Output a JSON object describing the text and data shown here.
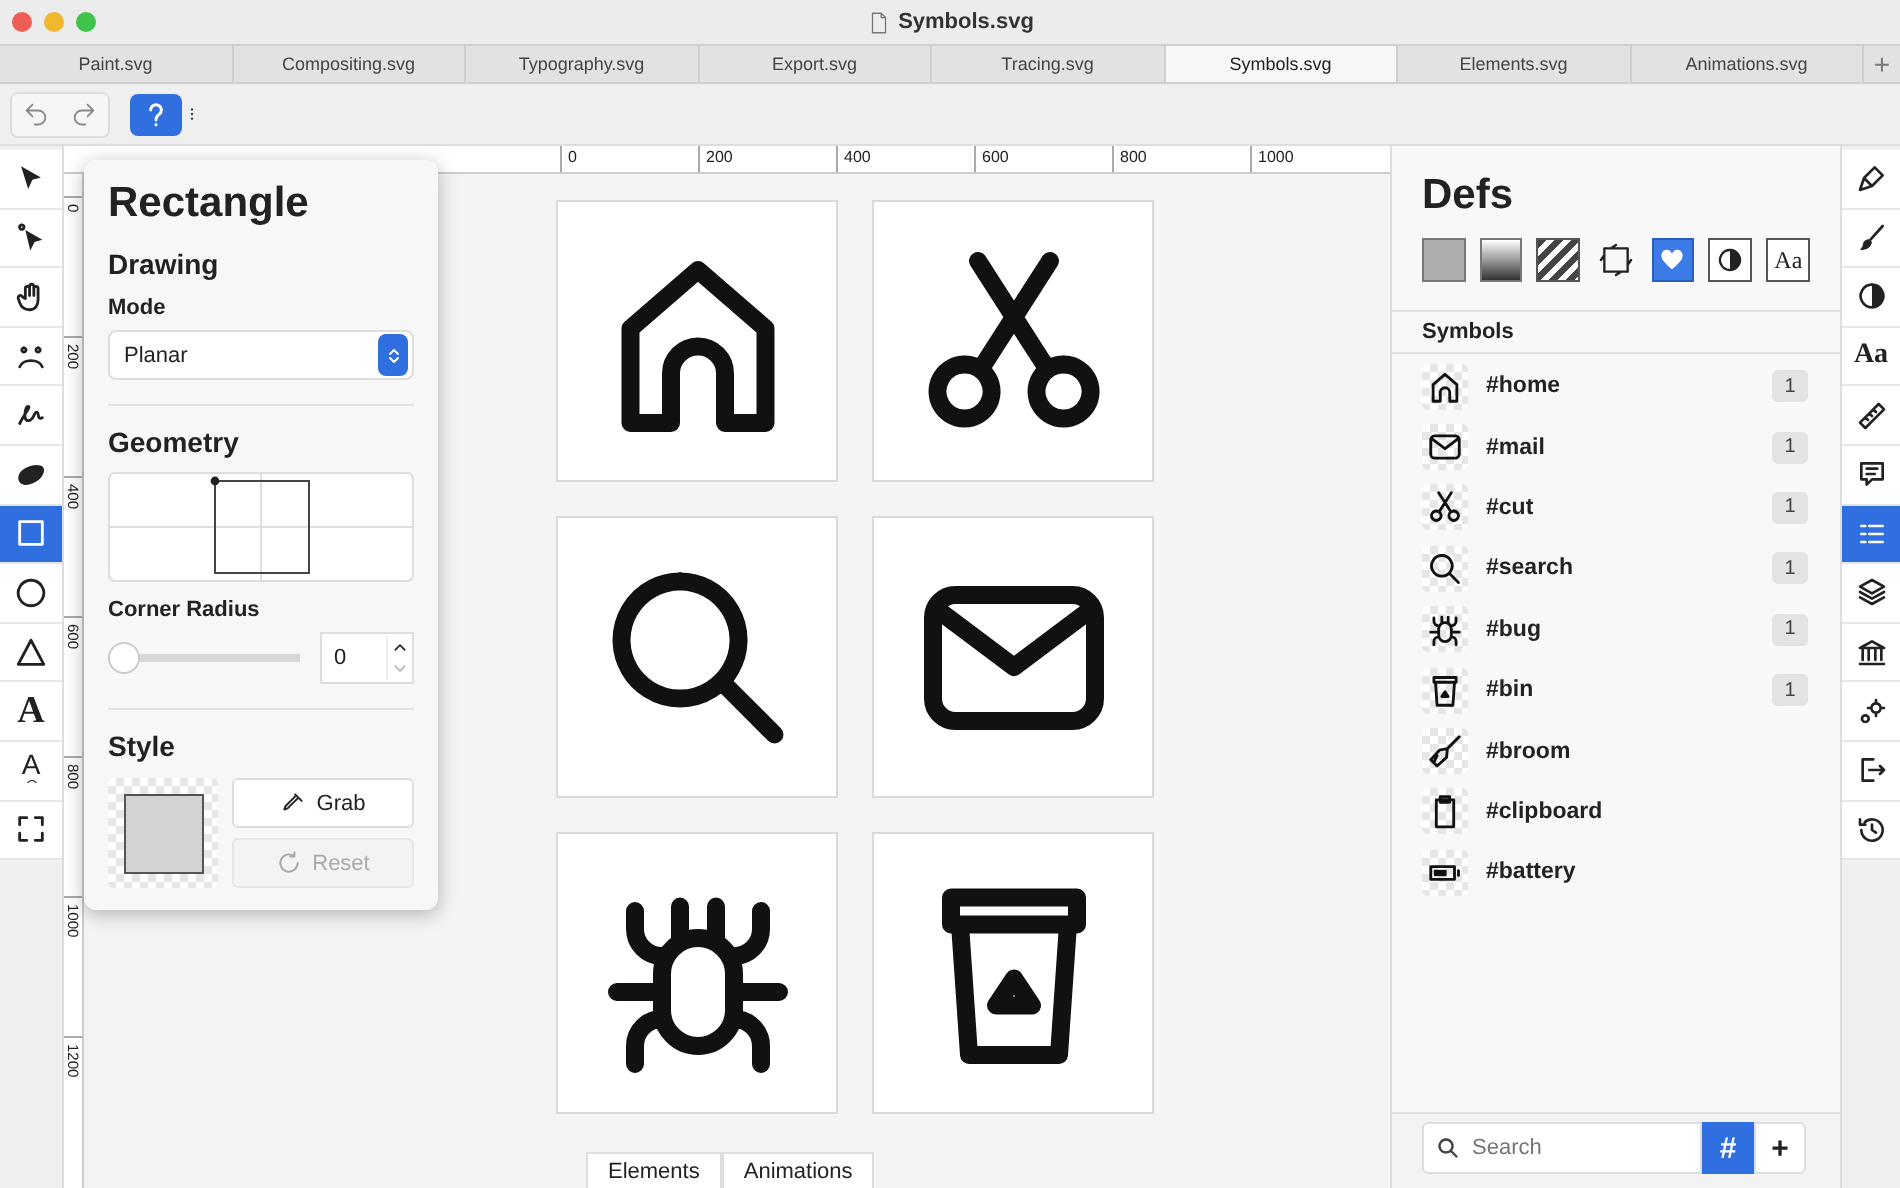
{
  "window": {
    "title": "Symbols.svg"
  },
  "tabs": [
    {
      "label": "Paint.svg",
      "selected": false
    },
    {
      "label": "Compositing.svg",
      "selected": false
    },
    {
      "label": "Typography.svg",
      "selected": false
    },
    {
      "label": "Export.svg",
      "selected": false
    },
    {
      "label": "Tracing.svg",
      "selected": false
    },
    {
      "label": "Symbols.svg",
      "selected": true
    },
    {
      "label": "Elements.svg",
      "selected": false
    },
    {
      "label": "Animations.svg",
      "selected": false
    }
  ],
  "new_tab_button": {
    "label": "+"
  },
  "toolbar": {
    "snap": {
      "on": true
    }
  },
  "left_tools": [
    {
      "kind": "select",
      "selected": false
    },
    {
      "kind": "direct",
      "selected": false
    },
    {
      "kind": "hand",
      "selected": false
    },
    {
      "kind": "nodes",
      "selected": false
    },
    {
      "kind": "freehand",
      "selected": false
    },
    {
      "kind": "blob",
      "selected": false
    },
    {
      "kind": "rect",
      "selected": true
    },
    {
      "kind": "ellipse",
      "selected": false
    },
    {
      "kind": "polygon",
      "selected": false
    },
    {
      "kind": "text",
      "glyph": "A",
      "selected": false
    },
    {
      "kind": "textpath",
      "glyph": "A",
      "selected": false
    },
    {
      "kind": "crop",
      "selected": false
    }
  ],
  "ruler_h": [
    "0",
    "200",
    "400",
    "600",
    "800",
    "1000"
  ],
  "ruler_v": [
    "0",
    "200",
    "400",
    "600",
    "800",
    "1000",
    "1200"
  ],
  "popover": {
    "title": "Rectangle",
    "drawing": {
      "heading": "Drawing",
      "mode_label": "Mode",
      "mode": "Planar"
    },
    "geometry": {
      "heading": "Geometry",
      "corner_radius_label": "Corner Radius",
      "corner_radius": "0",
      "level": 0
    },
    "style": {
      "heading": "Style",
      "buttons": [
        {
          "kind": "grab",
          "label": "Grab",
          "disabled": false
        },
        {
          "kind": "reset",
          "label": "Reset",
          "disabled": true
        }
      ]
    }
  },
  "canvas": {
    "symbols": [
      {
        "kind": "home"
      },
      {
        "kind": "cut"
      },
      {
        "kind": "search"
      },
      {
        "kind": "mail"
      },
      {
        "kind": "bug"
      },
      {
        "kind": "bin"
      }
    ],
    "bottom_tabs": [
      "Elements",
      "Animations"
    ]
  },
  "defs": {
    "title": "Defs",
    "types": [
      {
        "kind": "color",
        "selected": false
      },
      {
        "kind": "gradient",
        "selected": false
      },
      {
        "kind": "pattern",
        "selected": false
      },
      {
        "kind": "marker",
        "selected": false
      },
      {
        "kind": "symbol",
        "selected": true
      },
      {
        "kind": "mask",
        "selected": false
      },
      {
        "kind": "font",
        "glyph": "Aa",
        "selected": false
      }
    ],
    "section": "Symbols",
    "symbols": [
      {
        "kind": "home",
        "name": "#home",
        "count": "1"
      },
      {
        "kind": "mail",
        "name": "#mail",
        "count": "1"
      },
      {
        "kind": "cut",
        "name": "#cut",
        "count": "1"
      },
      {
        "kind": "search",
        "name": "#search",
        "count": "1"
      },
      {
        "kind": "bug",
        "name": "#bug",
        "count": "1"
      },
      {
        "kind": "bin",
        "name": "#bin",
        "count": "1"
      },
      {
        "kind": "broom",
        "name": "#broom"
      },
      {
        "kind": "clipboard",
        "name": "#clipboard"
      },
      {
        "kind": "battery",
        "name": "#battery"
      }
    ],
    "search": {
      "placeholder": "Search"
    },
    "hash_toggle": {
      "label": "#",
      "on": true
    },
    "add_button": {
      "label": "+"
    }
  },
  "right_tools": [
    {
      "kind": "nib",
      "selected": false
    },
    {
      "kind": "brush",
      "selected": false
    },
    {
      "kind": "contrast",
      "selected": false
    },
    {
      "kind": "text",
      "glyph": "Aa",
      "selected": false
    },
    {
      "kind": "ruler",
      "selected": false
    },
    {
      "kind": "comment",
      "selected": false
    },
    {
      "kind": "list",
      "selected": true
    },
    {
      "kind": "layers",
      "selected": false
    },
    {
      "kind": "bank",
      "selected": false
    },
    {
      "kind": "gears",
      "selected": false
    },
    {
      "kind": "export",
      "selected": false
    },
    {
      "kind": "history",
      "selected": false
    }
  ]
}
